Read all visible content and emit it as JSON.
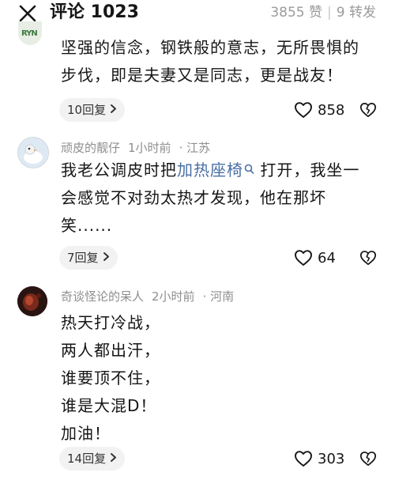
{
  "header": {
    "title": "评论 1023",
    "likes": "3855 赞",
    "separator": "|",
    "forwards": "9 转发"
  },
  "comments": [
    {
      "avatar_text": "RYN",
      "lines": [
        "坚强的信念，钢铁般的意志，无所畏惧的",
        "步伐，即是夫妻又是同志，更是战友！"
      ],
      "reply_label": "10回复",
      "likes": "858"
    },
    {
      "username": "顽皮的靓仔",
      "time": "1小时前",
      "location": "· 江苏",
      "line1_before": "我老公调皮时把",
      "line1_link": "加热座椅",
      "line1_after": " 打开，我坐一",
      "lines": [
        "会感觉不对劲太热才发现，他在那坏",
        "笑......"
      ],
      "reply_label": "7回复",
      "likes": "64"
    },
    {
      "username": "奇谈怪论的呆人",
      "time": "2小时前",
      "location": "· 河南",
      "lines": [
        "热天打冷战，",
        "两人都出汗，",
        "谁要顶不住，",
        "谁是大混D！",
        "加油！"
      ],
      "reply_label": "14回复",
      "likes": "303"
    }
  ]
}
